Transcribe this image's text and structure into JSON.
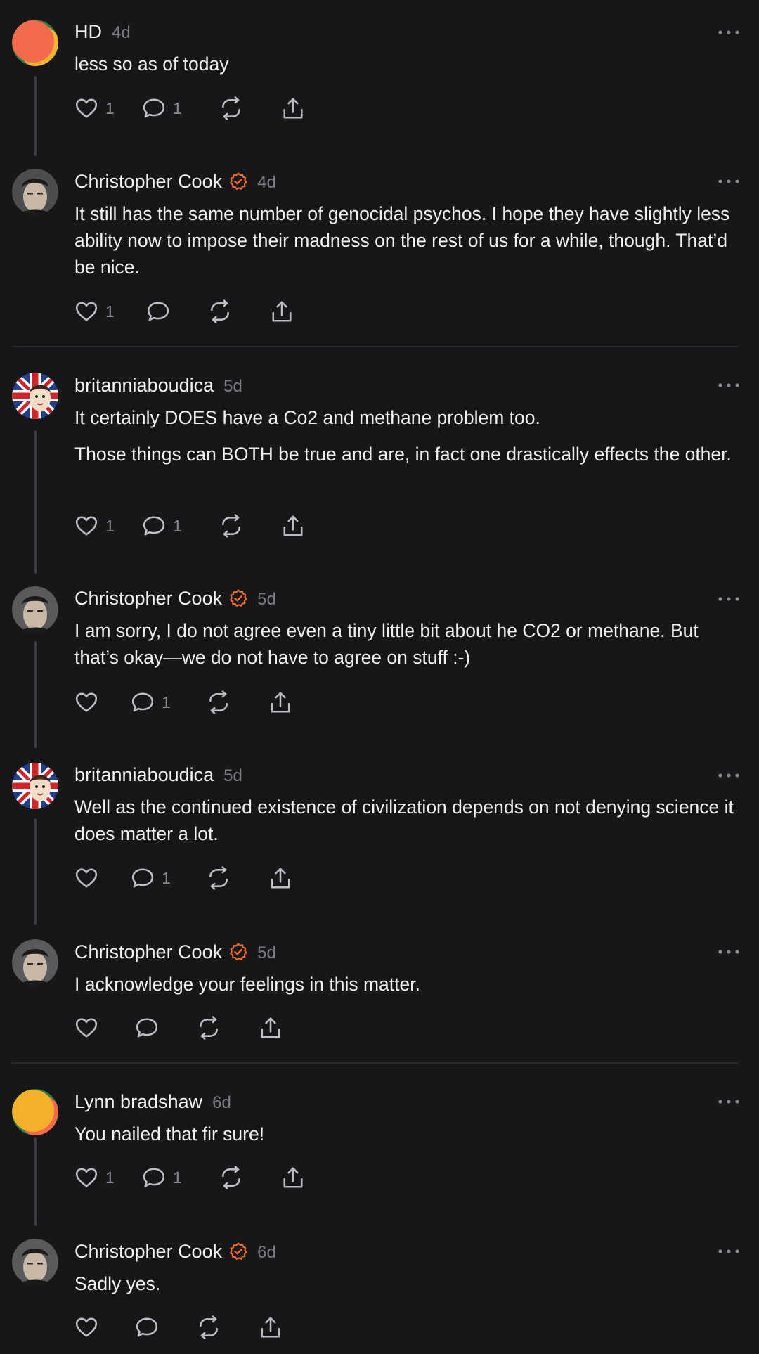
{
  "colors": {
    "background": "#161719",
    "accent": "#f46a2b",
    "muted": "#7d7e82"
  },
  "icons": {
    "like": "heart-icon",
    "reply": "speech-bubble-icon",
    "repost": "repost-icon",
    "share": "share-icon",
    "more": "ellipsis-icon",
    "verified": "verified-check-icon"
  },
  "posts": [
    {
      "author": "HD",
      "time": "4d",
      "verified": false,
      "paragraphs": [
        "less so as of today"
      ],
      "likes": "1",
      "replies": "1"
    },
    {
      "author": "Christopher Cook",
      "time": "4d",
      "verified": true,
      "paragraphs": [
        "It still has the same number of genocidal psychos. I hope they have slightly less ability now to impose their madness on the rest of us for a while, though. That’d be nice."
      ],
      "likes": "1",
      "replies": ""
    },
    {
      "author": "britanniaboudica",
      "time": "5d",
      "verified": false,
      "paragraphs": [
        "It certainly DOES have a Co2 and methane problem too.",
        "Those things can BOTH be true and are, in fact one drastically effects the other."
      ],
      "likes": "1",
      "replies": "1"
    },
    {
      "author": "Christopher Cook",
      "time": "5d",
      "verified": true,
      "paragraphs": [
        "I am sorry, I do not agree even a tiny little bit about he CO2 or methane. But that’s okay—we do not have to agree on stuff :-)"
      ],
      "likes": "",
      "replies": "1"
    },
    {
      "author": "britanniaboudica",
      "time": "5d",
      "verified": false,
      "paragraphs": [
        "Well as the continued existence of civilization depends on not denying science it does matter a lot."
      ],
      "likes": "",
      "replies": "1"
    },
    {
      "author": "Christopher Cook",
      "time": "5d",
      "verified": true,
      "paragraphs": [
        "I acknowledge your feelings in this matter."
      ],
      "likes": "",
      "replies": ""
    },
    {
      "author": "Lynn bradshaw",
      "time": "6d",
      "verified": false,
      "paragraphs": [
        "You nailed that fir sure!"
      ],
      "likes": "1",
      "replies": "1"
    },
    {
      "author": "Christopher Cook",
      "time": "6d",
      "verified": true,
      "paragraphs": [
        "Sadly yes."
      ],
      "likes": "",
      "replies": ""
    }
  ]
}
